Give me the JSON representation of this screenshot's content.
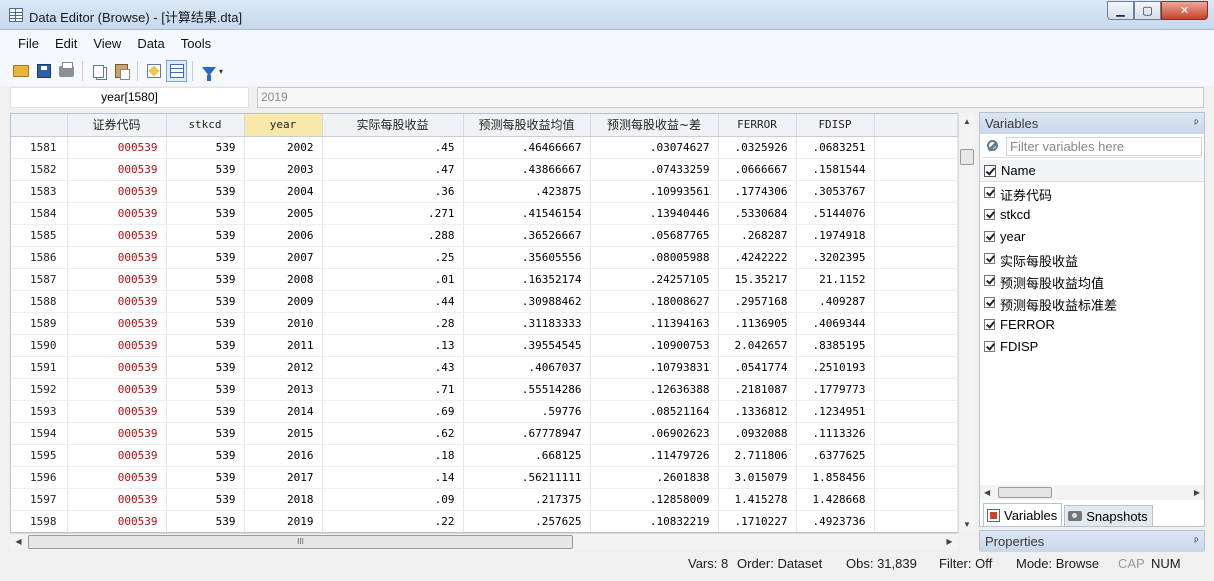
{
  "window": {
    "title": "Data Editor (Browse) - [计算结果.dta]",
    "min": "▁",
    "max": "▢",
    "close": "✕"
  },
  "menu": [
    "File",
    "Edit",
    "View",
    "Data",
    "Tools"
  ],
  "toolbar": {
    "icons": [
      "open-icon",
      "save-icon",
      "print-icon",
      "copy-icon",
      "paste-icon",
      "edit-mode-icon",
      "browse-mode-icon",
      "filter-icon"
    ],
    "filter_arrow": "▾"
  },
  "cell_ref": "year[1580]",
  "cell_value": "2019",
  "grid": {
    "columns": [
      "证券代码",
      "stkcd",
      "year",
      "实际每股收益",
      "预测每股收益均值",
      "预测每股收益~差",
      "FERROR",
      "FDISP"
    ],
    "selected_column": "year",
    "rows": [
      [
        "1581",
        "000539",
        "539",
        "2002",
        ".45",
        ".46466667",
        ".03074627",
        ".0325926",
        ".0683251"
      ],
      [
        "1582",
        "000539",
        "539",
        "2003",
        ".47",
        ".43866667",
        ".07433259",
        ".0666667",
        ".1581544"
      ],
      [
        "1583",
        "000539",
        "539",
        "2004",
        ".36",
        ".423875",
        ".10993561",
        ".1774306",
        ".3053767"
      ],
      [
        "1584",
        "000539",
        "539",
        "2005",
        ".271",
        ".41546154",
        ".13940446",
        ".5330684",
        ".5144076"
      ],
      [
        "1585",
        "000539",
        "539",
        "2006",
        ".288",
        ".36526667",
        ".05687765",
        ".268287",
        ".1974918"
      ],
      [
        "1586",
        "000539",
        "539",
        "2007",
        ".25",
        ".35605556",
        ".08005988",
        ".4242222",
        ".3202395"
      ],
      [
        "1587",
        "000539",
        "539",
        "2008",
        ".01",
        ".16352174",
        ".24257105",
        "15.35217",
        "21.1152"
      ],
      [
        "1588",
        "000539",
        "539",
        "2009",
        ".44",
        ".30988462",
        ".18008627",
        ".2957168",
        ".409287"
      ],
      [
        "1589",
        "000539",
        "539",
        "2010",
        ".28",
        ".31183333",
        ".11394163",
        ".1136905",
        ".4069344"
      ],
      [
        "1590",
        "000539",
        "539",
        "2011",
        ".13",
        ".39554545",
        ".10900753",
        "2.042657",
        ".8385195"
      ],
      [
        "1591",
        "000539",
        "539",
        "2012",
        ".43",
        ".4067037",
        ".10793831",
        ".0541774",
        ".2510193"
      ],
      [
        "1592",
        "000539",
        "539",
        "2013",
        ".71",
        ".55514286",
        ".12636388",
        ".2181087",
        ".1779773"
      ],
      [
        "1593",
        "000539",
        "539",
        "2014",
        ".69",
        ".59776",
        ".08521164",
        ".1336812",
        ".1234951"
      ],
      [
        "1594",
        "000539",
        "539",
        "2015",
        ".62",
        ".67778947",
        ".06902623",
        ".0932088",
        ".1113326"
      ],
      [
        "1595",
        "000539",
        "539",
        "2016",
        ".18",
        ".668125",
        ".11479726",
        "2.711806",
        ".6377625"
      ],
      [
        "1596",
        "000539",
        "539",
        "2017",
        ".14",
        ".56211111",
        ".2601838",
        "3.015079",
        "1.858456"
      ],
      [
        "1597",
        "000539",
        "539",
        "2018",
        ".09",
        ".217375",
        ".12858009",
        "1.415278",
        "1.428668"
      ],
      [
        "1598",
        "000539",
        "539",
        "2019",
        ".22",
        ".257625",
        ".10832219",
        ".1710227",
        ".4923736"
      ]
    ]
  },
  "scroll": {
    "up": "▲",
    "down": "▼",
    "left": "◀",
    "right": "▶",
    "grip": "III"
  },
  "variables_panel": {
    "title": "Variables",
    "pin": "ᵖ",
    "filter_placeholder": "Filter variables here",
    "header": "Name",
    "items": [
      "证券代码",
      "stkcd",
      "year",
      "实际每股收益",
      "预测每股收益均值",
      "预测每股收益标准差",
      "FERROR",
      "FDISP"
    ],
    "tabs": [
      "Variables",
      "Snapshots"
    ]
  },
  "properties_panel": {
    "title": "Properties",
    "pin": "ᵖ"
  },
  "status": {
    "vars": "Vars: 8",
    "order": "Order: Dataset",
    "obs": "Obs: 31,839",
    "filter": "Filter: Off",
    "mode": "Mode: Browse",
    "cap": "CAP",
    "num": "NUM"
  },
  "colors": {
    "string_value": "#b01010",
    "selected_header": "#f9e9a9",
    "panel_title": "#c9d7ea"
  }
}
